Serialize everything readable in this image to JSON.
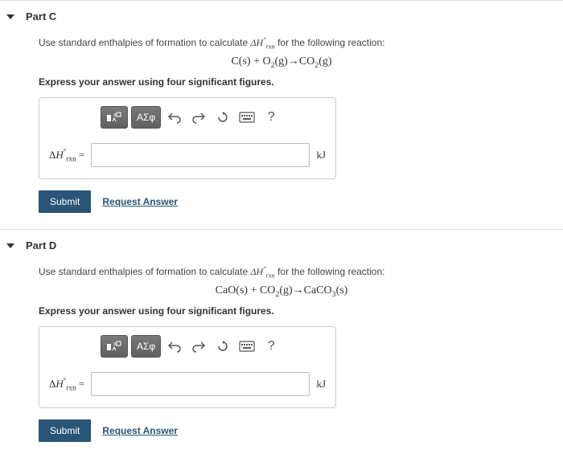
{
  "parts": [
    {
      "title": "Part C",
      "instruction_prefix": "Use standard enthalpies of formation to calculate ",
      "instruction_var": "ΔH°rxn",
      "instruction_suffix": " for the following reaction:",
      "equation_text": "C(s) + O2(g) → CO2(g)",
      "sigfig": "Express your answer using four significant figures.",
      "greek_label": "ΑΣφ",
      "help_label": "?",
      "var_prefix": "ΔH°rxn",
      "equals": " = ",
      "unit": "kJ",
      "submit": "Submit",
      "request": "Request Answer"
    },
    {
      "title": "Part D",
      "instruction_prefix": "Use standard enthalpies of formation to calculate ",
      "instruction_var": "ΔH°rxn",
      "instruction_suffix": " for the following reaction:",
      "equation_text": "CaO(s) + CO2(g) → CaCO3(s)",
      "sigfig": "Express your answer using four significant figures.",
      "greek_label": "ΑΣφ",
      "help_label": "?",
      "var_prefix": "ΔH°rxn",
      "equals": " = ",
      "unit": "kJ",
      "submit": "Submit",
      "request": "Request Answer"
    }
  ]
}
